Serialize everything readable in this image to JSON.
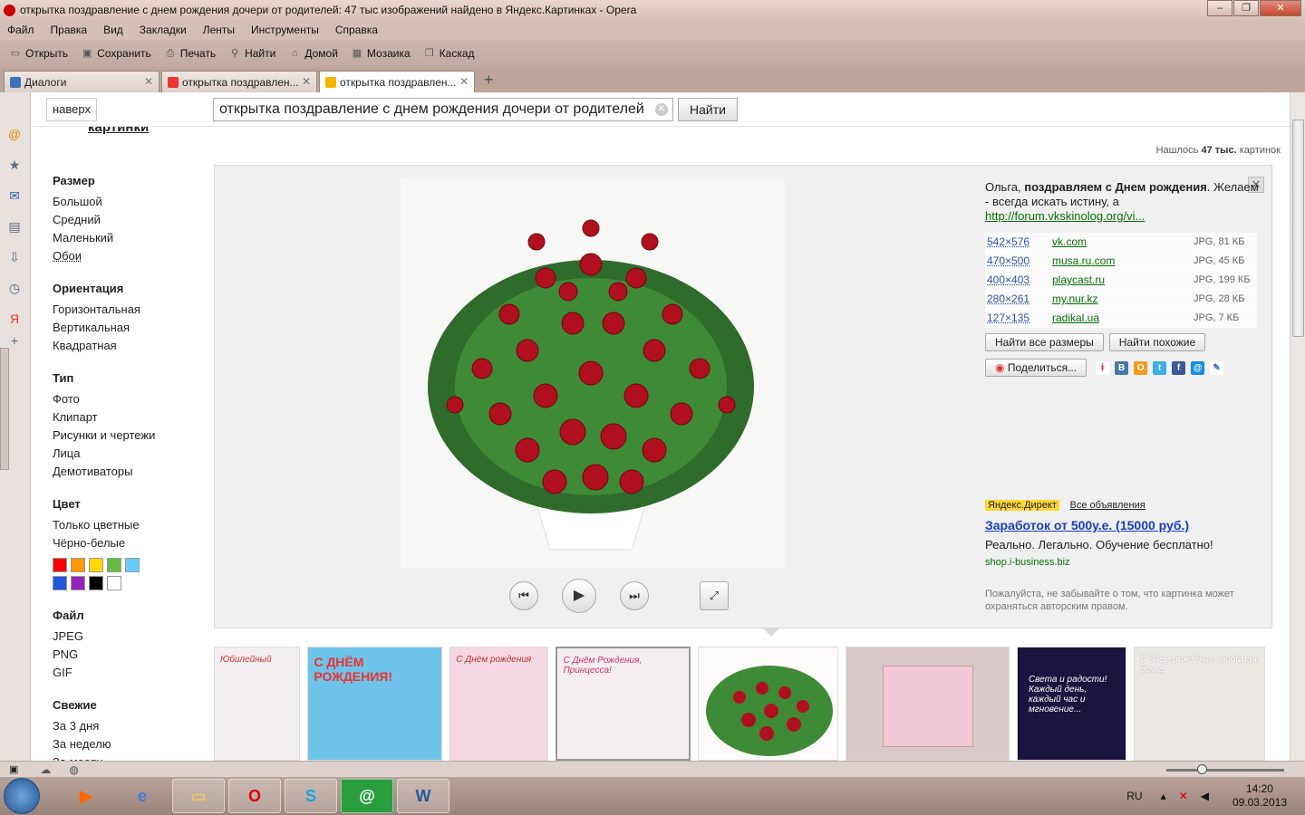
{
  "window": {
    "title": "открытка поздравление с днем рождения дочери от родителей: 47 тыс изображений найдено в Яндекс.Картинках - Opera"
  },
  "menu": [
    "Файл",
    "Правка",
    "Вид",
    "Закладки",
    "Ленты",
    "Инструменты",
    "Справка"
  ],
  "toolbar": {
    "open": "Открыть",
    "save": "Сохранить",
    "print": "Печать",
    "find": "Найти",
    "home": "Домой",
    "tile": "Мозаика",
    "cascade": "Каскад"
  },
  "tabs": [
    {
      "label": "Диалоги",
      "active": false
    },
    {
      "label": "открытка поздравлен...",
      "active": false
    },
    {
      "label": "открытка поздравлен...",
      "active": true
    }
  ],
  "search": {
    "up_label": "наверх",
    "query": "открытка поздравление с днем рождения дочери от родителей",
    "button": "Найти",
    "logo_cut": "картинки"
  },
  "found": {
    "prefix": "Нашлось",
    "count": "47 тыс.",
    "suffix": "картинок"
  },
  "filters": {
    "size": {
      "title": "Размер",
      "items": [
        "Большой",
        "Средний",
        "Маленький",
        "Обои"
      ]
    },
    "orientation": {
      "title": "Ориентация",
      "items": [
        "Горизонтальная",
        "Вертикальная",
        "Квадратная"
      ]
    },
    "type": {
      "title": "Тип",
      "items": [
        "Фото",
        "Клипарт",
        "Рисунки и чертежи",
        "Лица",
        "Демотиваторы"
      ]
    },
    "color": {
      "title": "Цвет",
      "items": [
        "Только цветные",
        "Чёрно-белые"
      ],
      "swatches": [
        "#ff0000",
        "#ff9900",
        "#ffd700",
        "#66bb44",
        "#66ccff",
        "#2255dd",
        "#9922bb",
        "#000000",
        "#ffffff"
      ]
    },
    "file": {
      "title": "Файл",
      "items": [
        "JPEG",
        "PNG",
        "GIF"
      ]
    },
    "fresh": {
      "title": "Свежие",
      "items": [
        "За 3 дня",
        "За неделю",
        "За месяц"
      ]
    }
  },
  "viewer": {
    "caption_name": "Ольга,",
    "caption_bold": "поздравляем с Днем рождения",
    "caption_rest": ". Желаем - всегда искать истину, а",
    "caption_link": "http://forum.vkskinolog.org/vi...",
    "sizes": [
      {
        "dim": "542×576",
        "site": "vk.com",
        "meta": "JPG, 81 КБ"
      },
      {
        "dim": "470×500",
        "site": "musa.ru.com",
        "meta": "JPG, 45 КБ"
      },
      {
        "dim": "400×403",
        "site": "playcast.ru",
        "meta": "JPG, 199 КБ"
      },
      {
        "dim": "280×261",
        "site": "my.nur.kz",
        "meta": "JPG, 28 КБ"
      },
      {
        "dim": "127×135",
        "site": "radikal.ua",
        "meta": "JPG, 7 КБ"
      }
    ],
    "all_sizes": "Найти все размеры",
    "similar": "Найти похожие",
    "share": "Поделиться...",
    "direct_label": "Яндекс.Директ",
    "direct_all": "Все объявления",
    "ad_title": "Заработок от 500у.е. (15000 руб.)",
    "ad_text": "Реально. Легально. Обучение бесплатно!",
    "ad_url": "shop.i-business.biz",
    "copyright": "Пожалуйста, не забывайте о том, что картинка может охраняться авторским правом."
  },
  "thumbs": [
    {
      "w": 96,
      "bg": "#f3eef0",
      "text": "Юбилейный"
    },
    {
      "w": 150,
      "bg": "#6ec3e8",
      "text": "С ДНЁМ РОЖДЕНИЯ!"
    },
    {
      "w": 110,
      "bg": "#f6d6e2",
      "text": "С Днём рождения"
    },
    {
      "w": 150,
      "bg": "#f4eef0",
      "text": "С Днём Рождения, Принцесса!"
    },
    {
      "w": 156,
      "bg": "#fdfafa",
      "text": ""
    },
    {
      "w": 182,
      "bg": "#d9c8c8",
      "text": ""
    },
    {
      "w": 122,
      "bg": "#1a1440",
      "text": "Света и радости! Каждый день, каждый час и мгновение..."
    },
    {
      "w": 146,
      "bg": "#ece8e4",
      "text": "С днем рожденья, любимая дочка!"
    }
  ],
  "tray": {
    "lang": "RU",
    "time": "14:20",
    "date": "09.03.2013"
  }
}
